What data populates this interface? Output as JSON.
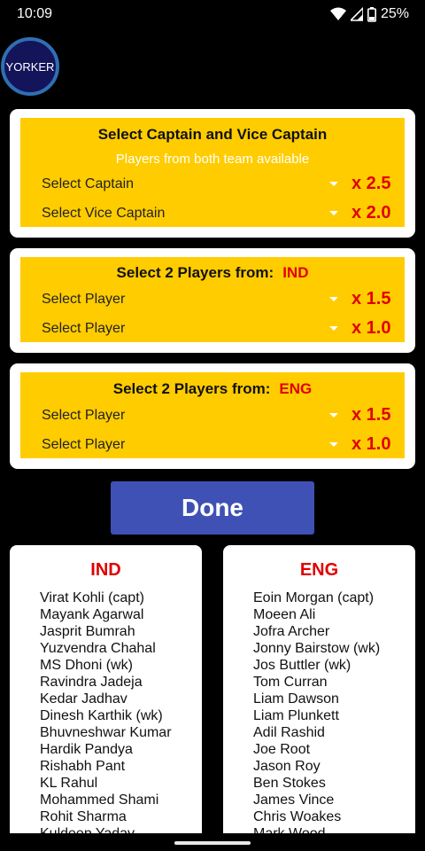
{
  "status_bar": {
    "time": "10:09",
    "battery": "25%",
    "icons": [
      "wifi-icon",
      "signal-icon",
      "battery-icon"
    ]
  },
  "logo": {
    "text": "YORKER"
  },
  "captain_card": {
    "title": "Select Captain and Vice Captain",
    "subtitle": "Players from both team available",
    "rows": [
      {
        "label": "Select Captain",
        "multiplier": "x 2.5"
      },
      {
        "label": "Select Vice Captain",
        "multiplier": "x 2.0"
      }
    ]
  },
  "team1_card": {
    "title": "Select 2 Players from:",
    "team": "IND",
    "rows": [
      {
        "label": "Select Player",
        "multiplier": "x 1.5"
      },
      {
        "label": "Select Player",
        "multiplier": "x 1.0"
      }
    ]
  },
  "team2_card": {
    "title": "Select 2 Players from:",
    "team": "ENG",
    "rows": [
      {
        "label": "Select Player",
        "multiplier": "x 1.5"
      },
      {
        "label": "Select Player",
        "multiplier": "x 1.0"
      }
    ]
  },
  "done_button": {
    "label": "Done"
  },
  "squads": {
    "ind": {
      "title": "IND",
      "players": [
        "Virat Kohli (capt)",
        "Mayank Agarwal",
        "Jasprit Bumrah",
        "Yuzvendra Chahal",
        "MS Dhoni (wk)",
        "Ravindra Jadeja",
        "Kedar Jadhav",
        "Dinesh Karthik (wk)",
        "Bhuvneshwar Kumar",
        "Hardik Pandya",
        "Rishabh Pant",
        "KL Rahul",
        "Mohammed Shami",
        "Rohit Sharma",
        "Kuldeep Yadav"
      ]
    },
    "eng": {
      "title": "ENG",
      "players": [
        "Eoin Morgan (capt)",
        "Moeen Ali",
        "Jofra Archer",
        "Jonny Bairstow (wk)",
        "Jos Buttler (wk)",
        "Tom Curran",
        "Liam Dawson",
        "Liam Plunkett",
        "Adil Rashid",
        "Joe Root",
        "Jason Roy",
        "Ben Stokes",
        "James Vince",
        "Chris Woakes",
        "Mark Wood"
      ]
    }
  },
  "colors": {
    "card_fill": "#ffcc00",
    "accent_red": "#e00000",
    "button_blue": "#3f51b5"
  }
}
